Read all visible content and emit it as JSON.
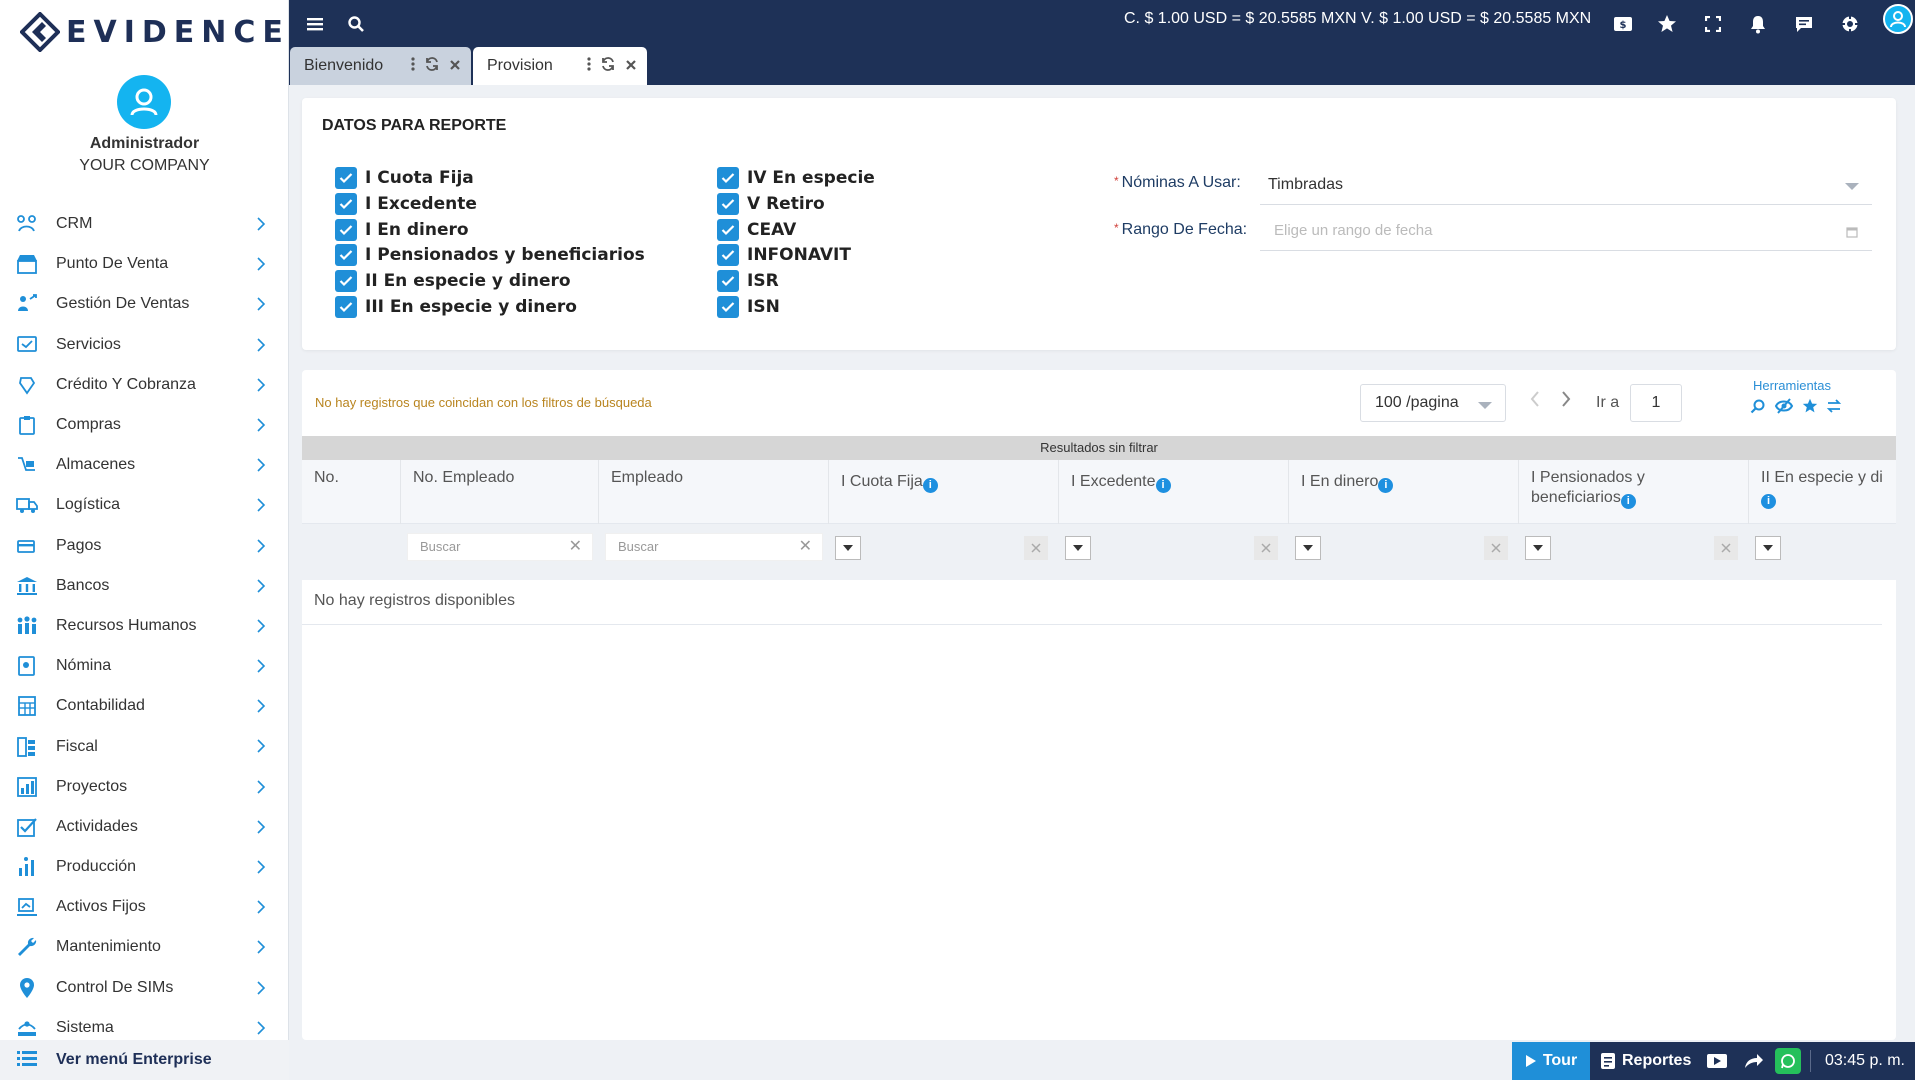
{
  "app": {
    "logo_text": "EVIDENCE"
  },
  "user": {
    "name": "Administrador",
    "company": "YOUR COMPANY"
  },
  "sidebar": {
    "items": [
      {
        "label": "CRM",
        "icon": "crm-icon"
      },
      {
        "label": "Punto De Venta",
        "icon": "store-icon"
      },
      {
        "label": "Gestión De Ventas",
        "icon": "sales-icon"
      },
      {
        "label": "Servicios",
        "icon": "services-icon"
      },
      {
        "label": "Crédito Y Cobranza",
        "icon": "credit-icon"
      },
      {
        "label": "Compras",
        "icon": "purchases-icon"
      },
      {
        "label": "Almacenes",
        "icon": "warehouse-icon"
      },
      {
        "label": "Logística",
        "icon": "truck-icon"
      },
      {
        "label": "Pagos",
        "icon": "payments-icon"
      },
      {
        "label": "Bancos",
        "icon": "bank-icon"
      },
      {
        "label": "Recursos Humanos",
        "icon": "people-icon"
      },
      {
        "label": "Nómina",
        "icon": "payroll-icon"
      },
      {
        "label": "Contabilidad",
        "icon": "accounting-icon"
      },
      {
        "label": "Fiscal",
        "icon": "fiscal-icon"
      },
      {
        "label": "Proyectos",
        "icon": "projects-icon"
      },
      {
        "label": "Actividades",
        "icon": "activities-icon"
      },
      {
        "label": "Producción",
        "icon": "production-icon"
      },
      {
        "label": "Activos Fijos",
        "icon": "assets-icon"
      },
      {
        "label": "Mantenimiento",
        "icon": "wrench-icon"
      },
      {
        "label": "Control De SIMs",
        "icon": "location-icon"
      },
      {
        "label": "Sistema",
        "icon": "system-icon"
      }
    ],
    "enterprise_label": "Ver menú Enterprise"
  },
  "topbar": {
    "rate_text": "C. $ 1.00 USD = $ 20.5585 MXN   V. $ 1.00 USD = $ 20.5585 MXN"
  },
  "tabs": [
    {
      "label": "Bienvenido",
      "active": false
    },
    {
      "label": "Provision",
      "active": true
    }
  ],
  "report": {
    "title": "DATOS PARA REPORTE",
    "checkboxes_left": [
      "I Cuota Fija",
      "I Excedente",
      "I En dinero",
      "I Pensionados y beneficiarios",
      "II En especie y dinero",
      "III En especie y dinero"
    ],
    "checkboxes_right": [
      "IV En especie",
      "V Retiro",
      "CEAV",
      "INFONAVIT",
      "ISR",
      "ISN"
    ],
    "nominas_label": "Nóminas A Usar:",
    "nominas_value": "Timbradas",
    "rango_label": "Rango De Fecha:",
    "rango_placeholder": "Elige un rango de fecha"
  },
  "results": {
    "no_match_text": "No hay registros que coincidan con los filtros de búsqueda",
    "per_page": "100 /pagina",
    "goto_label": "Ir a",
    "page": "1",
    "tools_label": "Herramientas",
    "band_text": "Resultados sin filtrar",
    "columns": [
      "No.",
      "No. Empleado",
      "Empleado",
      "I Cuota Fija",
      "I Excedente",
      "I En dinero",
      "I Pensionados y beneficiarios",
      "II En especie y di"
    ],
    "search_placeholder": "Buscar",
    "no_data_text": "No hay registros disponibles"
  },
  "bottombar": {
    "tour_label": "Tour",
    "reportes_label": "Reportes",
    "time": "03:45 p. m."
  },
  "colors": {
    "navy": "#1e3157",
    "accent": "#1f8fd8",
    "avatar": "#14b4f0"
  }
}
